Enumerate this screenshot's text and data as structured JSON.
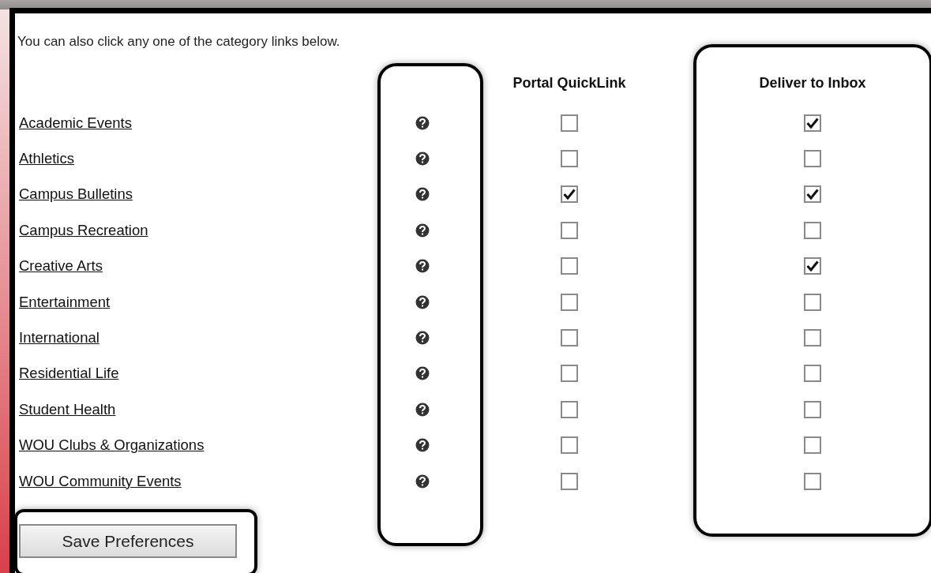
{
  "intro": "You can also click any one of the category links below.",
  "columns": {
    "portal": "Portal QuickLink",
    "deliver": "Deliver to Inbox"
  },
  "categories": [
    {
      "label": "Academic Events",
      "portal_quicklink": false,
      "deliver_to_inbox": true
    },
    {
      "label": "Athletics",
      "portal_quicklink": false,
      "deliver_to_inbox": false
    },
    {
      "label": "Campus Bulletins",
      "portal_quicklink": true,
      "deliver_to_inbox": true
    },
    {
      "label": "Campus Recreation",
      "portal_quicklink": false,
      "deliver_to_inbox": false
    },
    {
      "label": "Creative Arts",
      "portal_quicklink": false,
      "deliver_to_inbox": true
    },
    {
      "label": "Entertainment",
      "portal_quicklink": false,
      "deliver_to_inbox": false
    },
    {
      "label": "International",
      "portal_quicklink": false,
      "deliver_to_inbox": false
    },
    {
      "label": "Residential Life",
      "portal_quicklink": false,
      "deliver_to_inbox": false
    },
    {
      "label": "Student Health",
      "portal_quicklink": false,
      "deliver_to_inbox": false
    },
    {
      "label": "WOU Clubs & Organizations",
      "portal_quicklink": false,
      "deliver_to_inbox": false
    },
    {
      "label": "WOU Community Events",
      "portal_quicklink": false,
      "deliver_to_inbox": false
    }
  ],
  "save_button": "Save Preferences"
}
